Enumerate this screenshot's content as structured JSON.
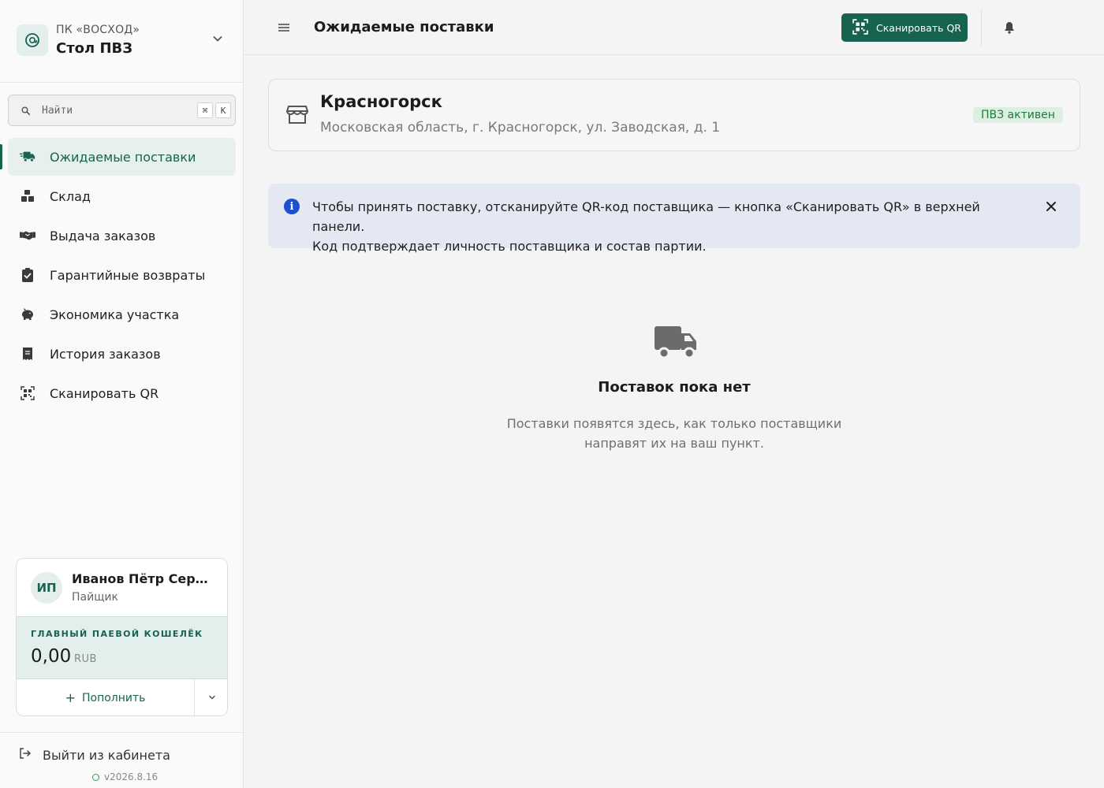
{
  "brand": {
    "org": "ПК «ВОСХОД»",
    "name": "Стол ПВЗ",
    "logo_icon": "leaf-at-icon"
  },
  "search": {
    "placeholder": "Найти",
    "shortcut_mod": "⌘",
    "shortcut_key": "K"
  },
  "nav": {
    "items": [
      {
        "label": "Ожидаемые поставки",
        "icon": "truck-fast-icon",
        "active": true
      },
      {
        "label": "Склад",
        "icon": "boxes-icon",
        "active": false
      },
      {
        "label": "Выдача заказов",
        "icon": "handshake-icon",
        "active": false
      },
      {
        "label": "Гарантийные возвраты",
        "icon": "clipboard-check-icon",
        "active": false
      },
      {
        "label": "Экономика участка",
        "icon": "piggy-bank-icon",
        "active": false
      },
      {
        "label": "История заказов",
        "icon": "receipt-icon",
        "active": false
      },
      {
        "label": "Сканировать QR",
        "icon": "qr-scan-icon",
        "active": false
      }
    ]
  },
  "user": {
    "initials": "ИП",
    "name": "Иванов Пётр Сергеевич",
    "role": "Пайщик",
    "wallet_label": "ГЛАВНЫЙ ПАЕВОЙ КОШЕЛЁК",
    "wallet_amount": "0,00",
    "wallet_currency": "RUB",
    "topup_label": "Пополнить"
  },
  "footer": {
    "logout_label": "Выйти из кабинета",
    "version": "v2026.8.16"
  },
  "topbar": {
    "title": "Ожидаемые поставки",
    "scan_label": "Сканировать QR"
  },
  "location": {
    "city": "Красногорск",
    "address": "Московская область, г. Красногорск, ул. Заводская, д. 1",
    "status": "ПВЗ активен"
  },
  "info": {
    "line1": "Чтобы принять поставку, отсканируйте QR-код поставщика — кнопка «Сканировать QR» в верхней панели.",
    "line2": "Код подтверждает личность поставщика и состав партии."
  },
  "empty": {
    "title": "Поставок пока нет",
    "description": "Поставки появятся здесь, как только поставщики направят их на ваш пункт."
  },
  "colors": {
    "accent": "#17634f",
    "accent_light": "#e3efec",
    "info_bg": "#e4e8f3",
    "info_icon": "#1f4fd1",
    "success": "#1f7a3a",
    "success_bg": "#dcefe0"
  }
}
